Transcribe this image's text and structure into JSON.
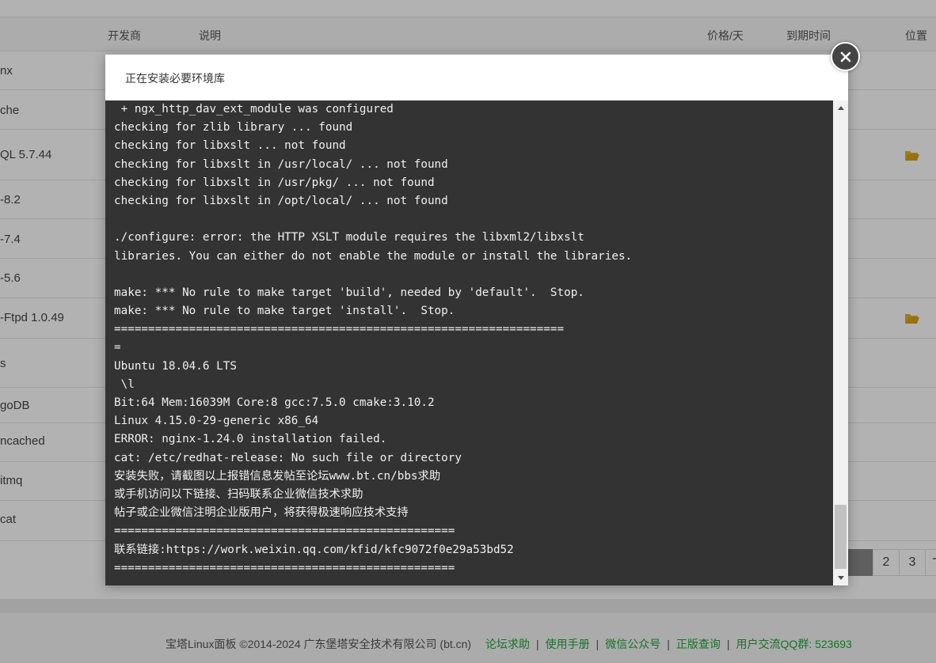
{
  "table": {
    "headers": {
      "developer": "开发商",
      "description": "说明",
      "price": "价格/天",
      "expiry": "到期时间",
      "location": "位置"
    },
    "rows": [
      {
        "name": "nx"
      },
      {
        "name": "che"
      },
      {
        "name": "QL 5.7.44"
      },
      {
        "name": "-8.2"
      },
      {
        "name": "-7.4"
      },
      {
        "name": "-5.6"
      },
      {
        "name": "-Ftpd 1.0.49"
      },
      {
        "name": "s"
      },
      {
        "name": "goDB"
      },
      {
        "name": "ncached"
      },
      {
        "name": "itmq"
      },
      {
        "name": "cat"
      }
    ]
  },
  "pager": {
    "p2": "2",
    "p3": "3",
    "next": "下"
  },
  "footer": {
    "copyright": "宝塔Linux面板 ©2014-2024 广东堡塔安全技术有限公司 (bt.cn)",
    "forum": "论坛求助",
    "manual": "使用手册",
    "wechat": "微信公众号",
    "verify": "正版查询",
    "qq": "用户交流QQ群: 523693"
  },
  "dialog": {
    "title": "正在安装必要环境库",
    "lines": [
      " + ngx_http_dav_ext_module was configured",
      "checking for zlib library ... found",
      "checking for libxslt ... not found",
      "checking for libxslt in /usr/local/ ... not found",
      "checking for libxslt in /usr/pkg/ ... not found",
      "checking for libxslt in /opt/local/ ... not found",
      "",
      "./configure: error: the HTTP XSLT module requires the libxml2/libxslt",
      "libraries. You can either do not enable the module or install the libraries.",
      "",
      "make: *** No rule to make target 'build', needed by 'default'.  Stop.",
      "make: *** No rule to make target 'install'.  Stop.",
      "==================================================================",
      "=",
      "Ubuntu 18.04.6 LTS",
      " \\l",
      "Bit:64 Mem:16039M Core:8 gcc:7.5.0 cmake:3.10.2",
      "Linux 4.15.0-29-generic x86_64",
      "ERROR: nginx-1.24.0 installation failed.",
      "cat: /etc/redhat-release: No such file or directory",
      "安装失败，请截图以上报错信息发帖至论坛www.bt.cn/bbs求助",
      "或手机访问以下链接、扫码联系企业微信技术求助",
      "帖子或企业微信注明企业版用户，将获得极速响应技术支持",
      "==================================================",
      "联系链接:https://work.weixin.qq.com/kfid/kfc9072f0e29a53bd52",
      "=================================================="
    ]
  },
  "colors": {
    "terminal_bg": "#333333",
    "terminal_text": "#f0f0f0",
    "link_green": "#20a53a",
    "folder_yellow": "#e6b325"
  }
}
